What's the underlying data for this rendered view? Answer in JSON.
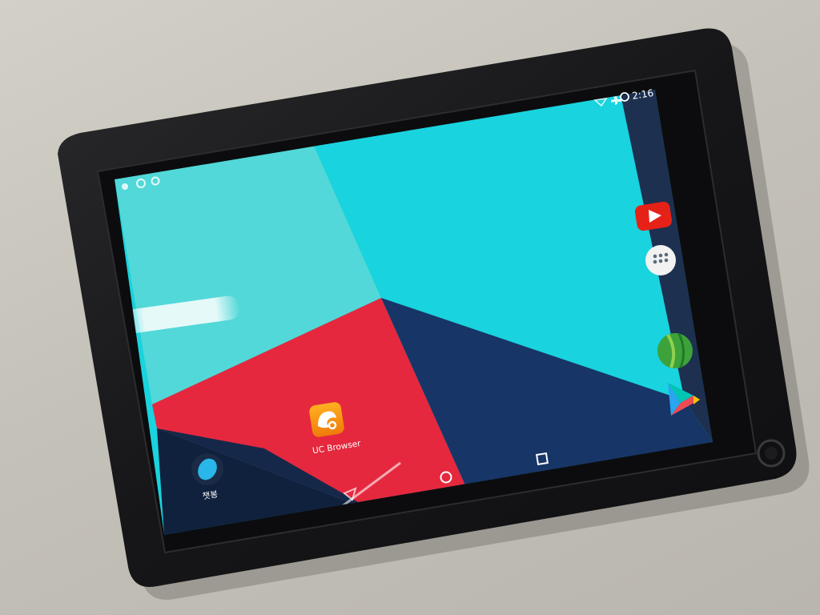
{
  "status_bar": {
    "time": "2:16",
    "icons": [
      "wifi-icon",
      "airplane-icon",
      "alarm-icon"
    ],
    "notification_icons": [
      "download-icon",
      "sync-icon",
      "settings-icon"
    ]
  },
  "home_screen": {
    "apps": [
      {
        "id": "uc-browser",
        "label": "UC Browser",
        "icon": "squirrel-icon",
        "color": "#f59a12"
      },
      {
        "id": "chatbot",
        "label": "챗봉",
        "icon": "bubble-icon",
        "color": "#2ab6e8"
      }
    ],
    "dock": [
      {
        "id": "youtube",
        "icon": "play-icon",
        "color": "#e62117"
      },
      {
        "id": "app-drawer",
        "icon": "grid-dots-icon",
        "color": "#f2f2f2"
      },
      {
        "id": "green-app",
        "icon": "leaf-ball-icon",
        "color": "#3da23a"
      },
      {
        "id": "play-store",
        "icon": "play-store-icon",
        "color": "#00c4b4"
      }
    ]
  },
  "nav_bar": {
    "buttons": [
      "back-icon",
      "home-icon",
      "recents-icon"
    ]
  },
  "wallpaper": {
    "colors": {
      "cyan_light": "#52d8d8",
      "cyan": "#19d3de",
      "red": "#e5283e",
      "navy": "#173566",
      "dark_navy": "#10213d",
      "slate": "#1d2f4d"
    }
  },
  "device": {
    "bezel_color": "#19191b"
  }
}
